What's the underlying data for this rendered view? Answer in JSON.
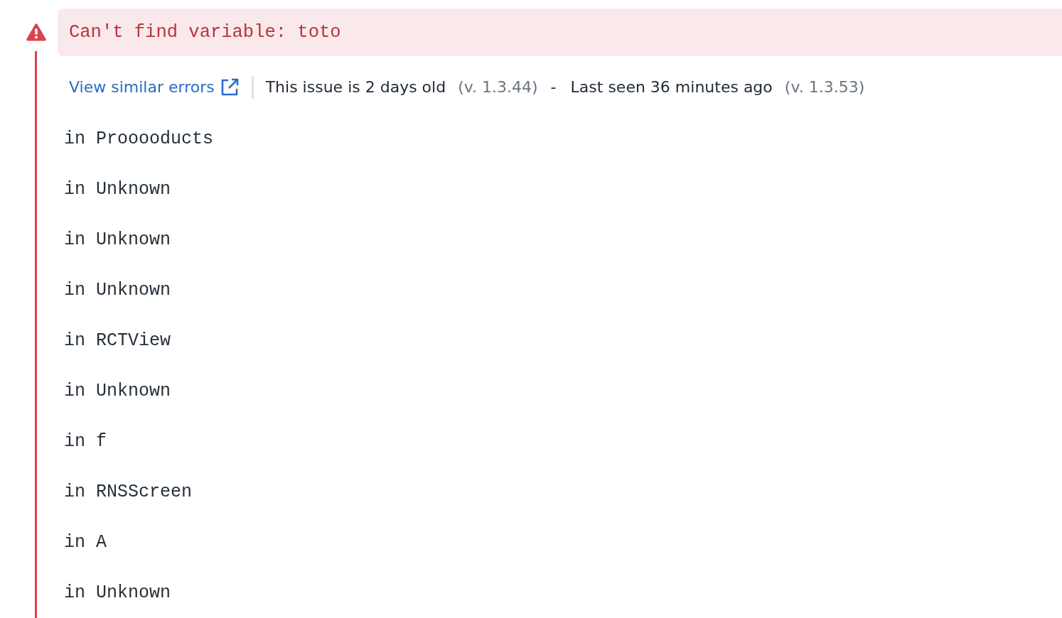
{
  "error": {
    "message": "Can't find variable: toto"
  },
  "meta": {
    "link": "View similar errors",
    "first_seen": "This issue is 2 days old",
    "first_version": "(v. 1.3.44)",
    "separator": "-",
    "last_seen": "Last seen 36 minutes ago",
    "last_version": "(v. 1.3.53)"
  },
  "stack": [
    "in Prooooducts",
    "in Unknown",
    "in Unknown",
    "in Unknown",
    "in RCTView",
    "in Unknown",
    "in f",
    "in RNSScreen",
    "in A",
    "in Unknown"
  ]
}
